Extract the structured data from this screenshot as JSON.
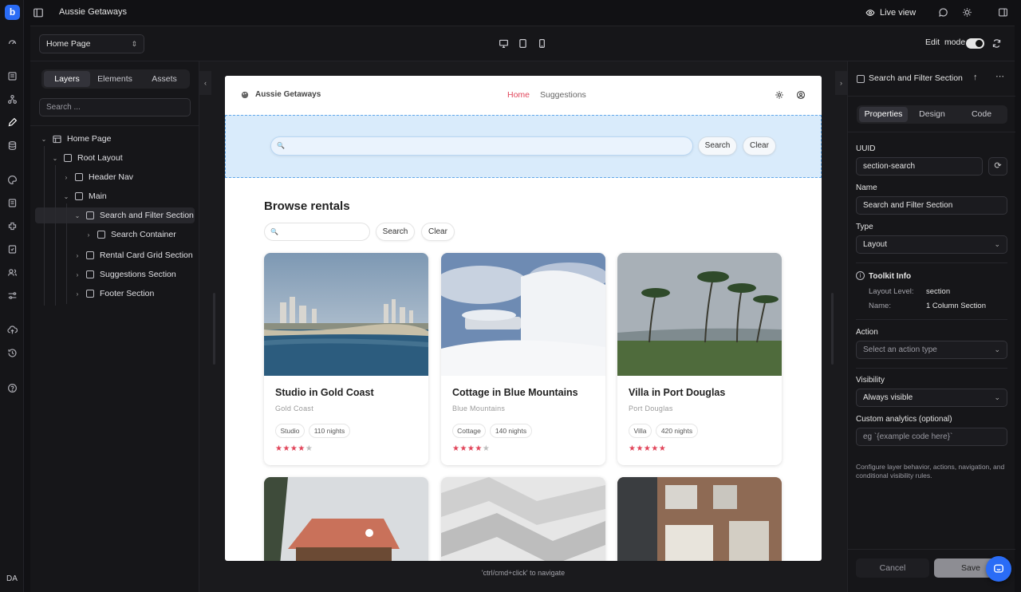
{
  "app": {
    "title": "Aussie Getaways",
    "live_view": "Live view",
    "user_initials": "DA",
    "logo_letter": "b"
  },
  "toolbar": {
    "page_select": "Home Page",
    "edit_label": "Edit",
    "mode_label": "mode",
    "edit_mode_on": true
  },
  "left_panel": {
    "tabs": [
      "Layers",
      "Elements",
      "Assets"
    ],
    "active_tab": "Layers",
    "search_placeholder": "Search ...",
    "tree": [
      {
        "label": "Home Page",
        "depth": 0,
        "expanded": true,
        "icon": "page-icon"
      },
      {
        "label": "Root Layout",
        "depth": 1,
        "expanded": true
      },
      {
        "label": "Header Nav",
        "depth": 2,
        "expanded": false
      },
      {
        "label": "Main",
        "depth": 2,
        "expanded": true
      },
      {
        "label": "Search and Filter Section",
        "depth": 3,
        "expanded": true,
        "selected": true
      },
      {
        "label": "Search Container",
        "depth": 4,
        "expanded": false
      },
      {
        "label": "Rental Card Grid Section",
        "depth": 3,
        "expanded": false
      },
      {
        "label": "Suggestions Section",
        "depth": 3,
        "expanded": false
      },
      {
        "label": "Footer Section",
        "depth": 3,
        "expanded": false
      }
    ]
  },
  "canvas": {
    "hint": "'ctrl/cmd+click' to navigate"
  },
  "site": {
    "brand": "Aussie Getaways",
    "nav": [
      "Home",
      "Suggestions"
    ],
    "active_nav": "Home",
    "accent": "#e1455a",
    "hero_search_button": "Search",
    "hero_clear_button": "Clear",
    "browse_title": "Browse rentals",
    "browse_search_button": "Search",
    "browse_clear_button": "Clear",
    "cards": [
      {
        "title": "Studio in Gold Coast",
        "location": "Gold Coast",
        "type": "Studio",
        "nights": "110 nights",
        "rating": 4
      },
      {
        "title": "Cottage in Blue Mountains",
        "location": "Blue Mountains",
        "type": "Cottage",
        "nights": "140 nights",
        "rating": 4
      },
      {
        "title": "Villa in Port Douglas",
        "location": "Port Douglas",
        "type": "Villa",
        "nights": "420 nights",
        "rating": 5
      }
    ]
  },
  "right_panel": {
    "title": "Search and Filter Section",
    "tabs": [
      "Properties",
      "Design",
      "Code"
    ],
    "active_tab": "Properties",
    "uuid_label": "UUID",
    "uuid_value": "section-search",
    "name_label": "Name",
    "name_value": "Search and Filter Section",
    "type_label": "Type",
    "type_value": "Layout",
    "toolkit_title": "Toolkit Info",
    "layout_level_key": "Layout Level:",
    "layout_level_value": "section",
    "toolkit_name_key": "Name:",
    "toolkit_name_value": "1 Column Section",
    "action_label": "Action",
    "action_placeholder": "Select an action type",
    "visibility_label": "Visibility",
    "visibility_value": "Always visible",
    "analytics_label": "Custom analytics (optional)",
    "analytics_placeholder": "eg `{example code here}`",
    "help_text": "Configure layer behavior, actions, navigation, and conditional visibility rules.",
    "cancel": "Cancel",
    "save": "Save"
  }
}
